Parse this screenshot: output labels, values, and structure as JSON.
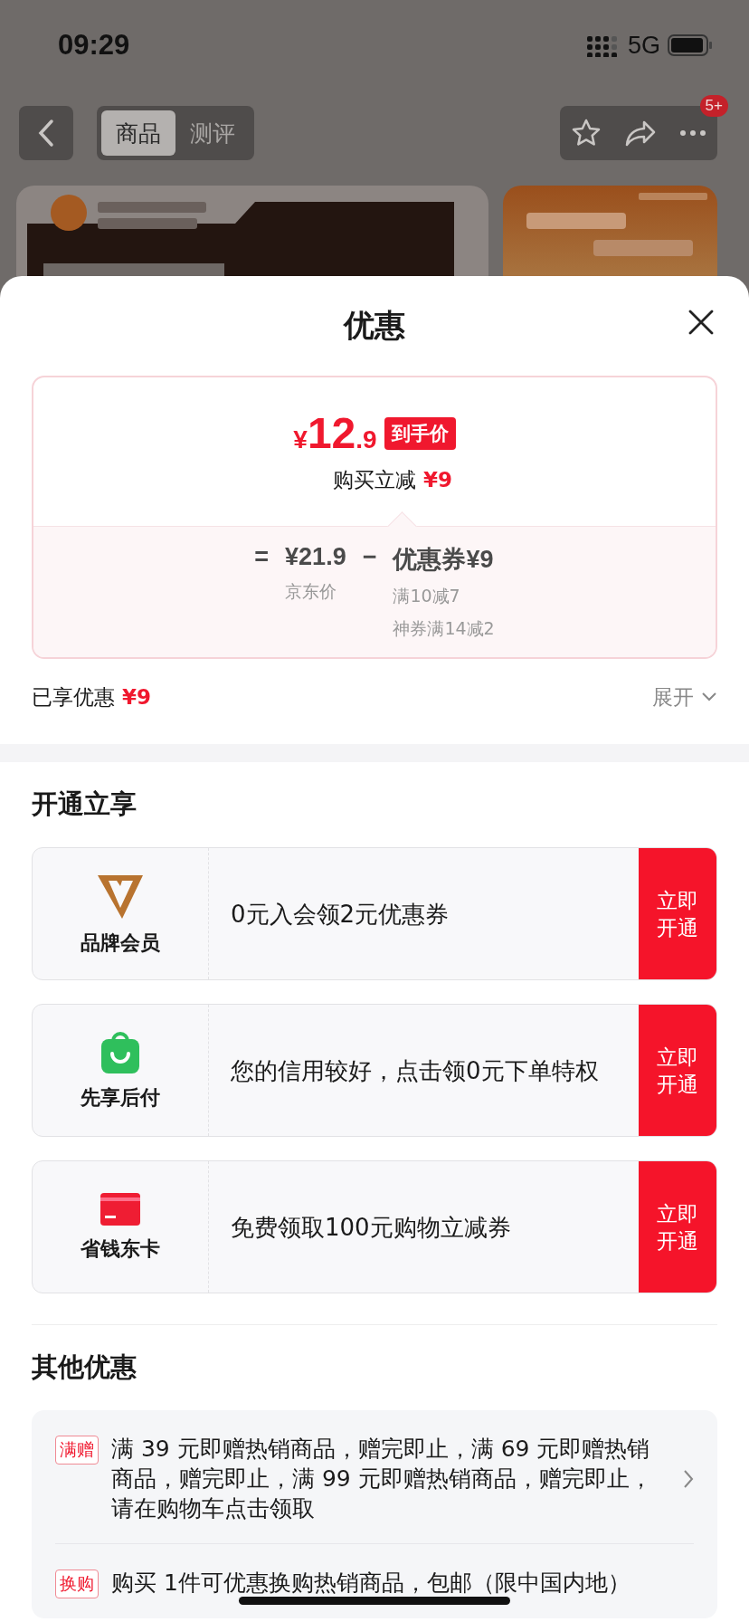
{
  "status_bar": {
    "time": "09:29",
    "network": "5G"
  },
  "nav": {
    "tabs": [
      {
        "label": "商品",
        "selected": true
      },
      {
        "label": "测评",
        "selected": false
      }
    ],
    "badge": "5+"
  },
  "sheet": {
    "title": "优惠",
    "price": {
      "currency": "¥",
      "integer": "12",
      "decimal": ".9",
      "tag": "到手价"
    },
    "instant": {
      "label": "购买立减",
      "amount": "¥9"
    },
    "breakdown": {
      "equals": "=",
      "base": "¥21.9",
      "base_label": "京东价",
      "minus": "−",
      "coupon": "优惠券¥9",
      "details": [
        "满10减7",
        "神券满14减2"
      ]
    },
    "enjoyed": {
      "label": "已享优惠",
      "amount": "¥9"
    },
    "expand": "展开",
    "memberships": {
      "title": "开通立享",
      "items": [
        {
          "kind": "brand",
          "label": "品牌会员",
          "text": "0元入会领2元优惠券",
          "button": "立即开通"
        },
        {
          "kind": "paylater",
          "label": "先享后付",
          "text": "您的信用较好，点击领0元下单特权",
          "button": "立即开通"
        },
        {
          "kind": "card",
          "label": "省钱东卡",
          "text": "免费领取100元购物立减券",
          "button": "立即开通"
        }
      ]
    },
    "others": {
      "title": "其他优惠",
      "items": [
        {
          "tag": "满赠",
          "text": "满 39 元即赠热销商品，赠完即止，满 69 元即赠热销商品，赠完即止，满 99 元即赠热销商品，赠完即止，请在购物车点击领取",
          "arrow": true
        },
        {
          "tag": "换购",
          "text": "购买 1件可优惠换购热销商品，包邮（限中国内地）",
          "arrow": false
        }
      ]
    }
  }
}
